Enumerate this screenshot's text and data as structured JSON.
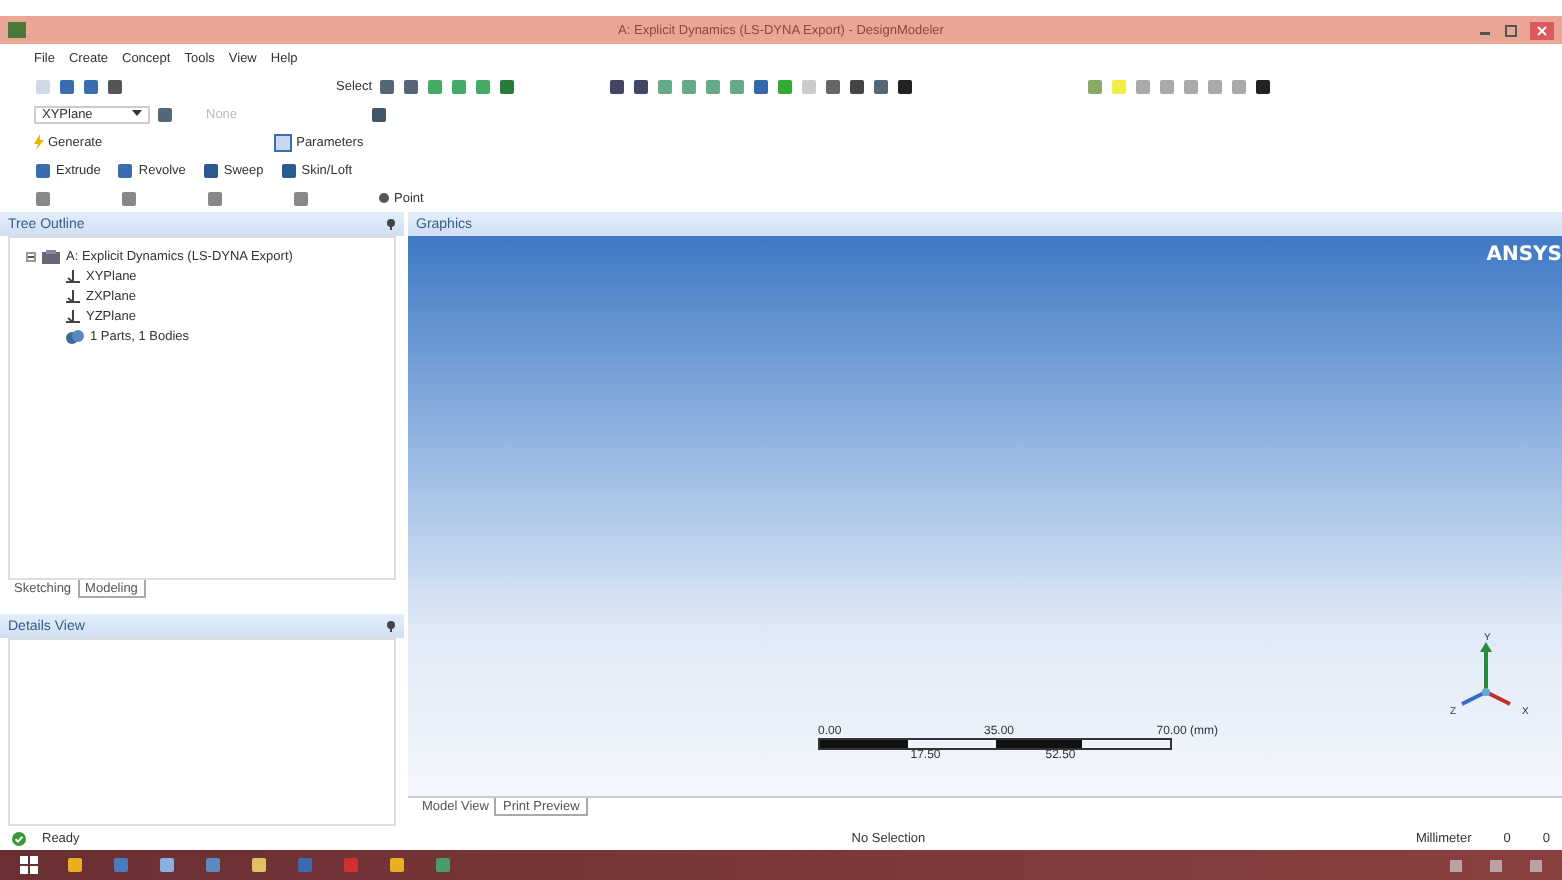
{
  "window": {
    "title": "A: Explicit Dynamics (LS-DYNA Export) - DesignModeler"
  },
  "menu": [
    "File",
    "Create",
    "Concept",
    "Tools",
    "View",
    "Help"
  ],
  "toolbar": {
    "select_label": "Select",
    "plane": "XYPlane",
    "sketch": {
      "label": "None",
      "disabled": true
    },
    "generate": "Generate",
    "parameters": "Parameters",
    "features": [
      "Extrude",
      "Revolve",
      "Sweep",
      "Skin/Loft"
    ],
    "point": "Point"
  },
  "tree_outline": {
    "title": "Tree Outline",
    "items": [
      {
        "label": "A: Explicit Dynamics (LS-DYNA Export)",
        "kind": "model",
        "expanded": true,
        "children": [
          {
            "label": "XYPlane",
            "kind": "plane"
          },
          {
            "label": "ZXPlane",
            "kind": "plane"
          },
          {
            "label": "YZPlane",
            "kind": "plane"
          },
          {
            "label": "1 Parts, 1 Bodies",
            "kind": "parts"
          }
        ]
      }
    ],
    "tabs": [
      {
        "label": "Sketching",
        "selected": false
      },
      {
        "label": "Modeling",
        "selected": true
      }
    ]
  },
  "details_view": {
    "title": "Details View"
  },
  "graphics": {
    "title": "Graphics",
    "logo": "ANSYS",
    "scale": {
      "top_labels": [
        "0.00",
        "35.00",
        "70.00 (mm)"
      ],
      "bottom_labels": [
        "17.50",
        "52.50"
      ]
    },
    "axes": [
      "X",
      "Y",
      "Z"
    ],
    "tabs": [
      {
        "label": "Model View",
        "selected": false
      },
      {
        "label": "Print Preview",
        "selected": true
      }
    ]
  },
  "status_bar": {
    "message": "Ready",
    "selection": "No Selection",
    "units": "Millimeter",
    "values": [
      "0",
      "0"
    ]
  }
}
